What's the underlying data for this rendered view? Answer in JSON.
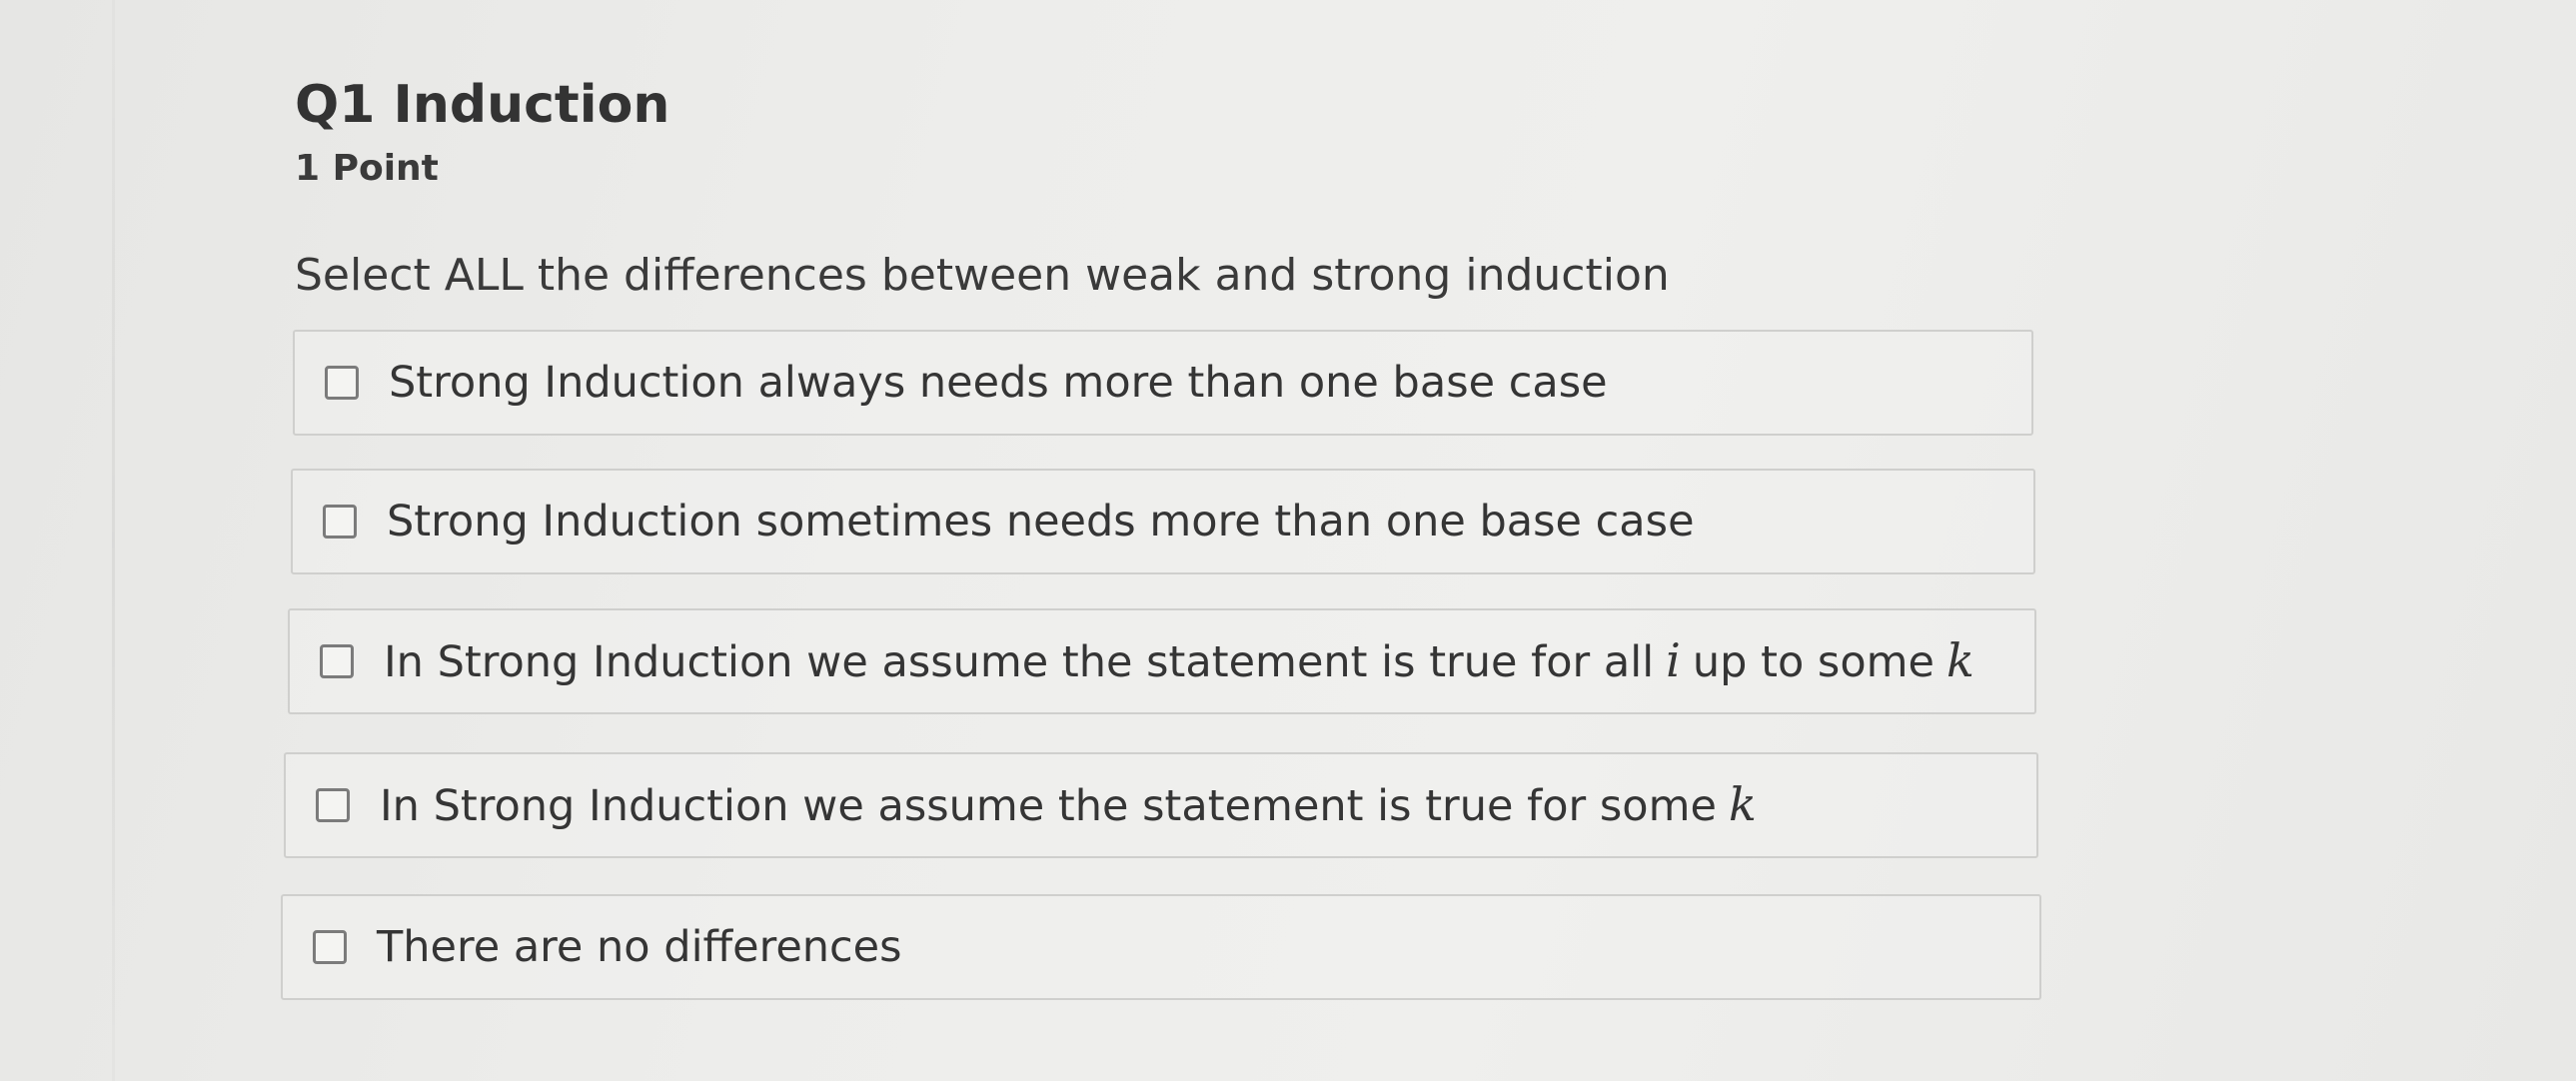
{
  "question": {
    "title": "Q1 Induction",
    "points": "1 Point",
    "prompt": "Select ALL the differences between weak and strong induction"
  },
  "options": [
    {
      "label": "Strong Induction always needs more than one base case",
      "checked": false
    },
    {
      "label": "Strong Induction sometimes needs more than one base case",
      "checked": false
    },
    {
      "label_before": "In Strong Induction we assume the statement is true for all",
      "math_1": "i",
      "label_middle": "up to some",
      "math_2": "k",
      "checked": false
    },
    {
      "label_before": "In Strong Induction we assume the statement is true for some",
      "math_1": "k",
      "checked": false
    },
    {
      "label": "There are no differences",
      "checked": false
    }
  ]
}
